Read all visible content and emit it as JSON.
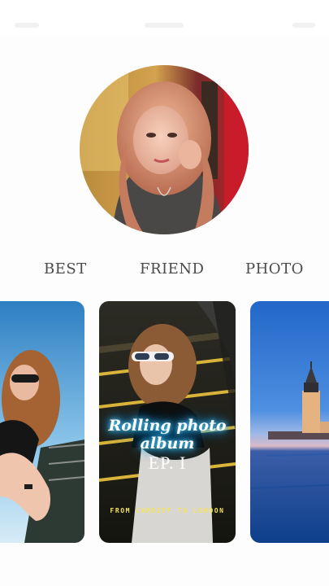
{
  "heading": {
    "words": [
      "BEST",
      "FRIEND",
      "PHOTO"
    ]
  },
  "album": {
    "title": "Rolling photo album",
    "episode": "EP. I",
    "subtitle": "FROM CARDIFF TO LONDON"
  },
  "colors": {
    "background": "#fdfdfd",
    "heading_text": "#4a4a4a",
    "neon_glow": "#26b5ff",
    "subtitle_yellow": "#f4e45a"
  }
}
